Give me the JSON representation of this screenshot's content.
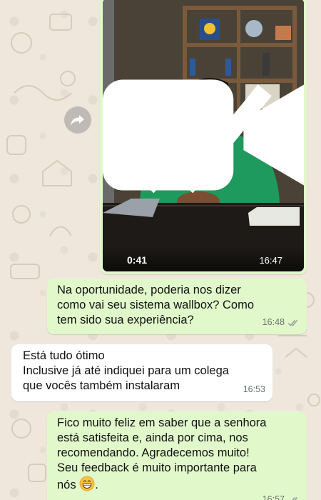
{
  "video": {
    "duration": "0:41",
    "time": "16:47",
    "icons": [
      "video-camera-icon",
      "play-icon",
      "forward-icon",
      "double-check-icon"
    ]
  },
  "messages": [
    {
      "direction": "outgoing",
      "lines": [
        "Na oportunidade, poderia nos dizer",
        "como vai seu sistema wallbox? Como",
        "tem sido sua experiência?"
      ],
      "time": "16:48",
      "status": "read"
    },
    {
      "direction": "incoming",
      "lines": [
        "Está tudo ótimo",
        "Inclusive já até indiquei para um colega",
        "que vocês também instalaram"
      ],
      "time": "16:53"
    },
    {
      "direction": "outgoing",
      "lines": [
        "Fico muito feliz em saber que a senhora",
        "está satisfeita e, ainda por cima, nos",
        "recomendando. Agradecemos muito!",
        "Seu feedback é muito importante para",
        "nós"
      ],
      "line_suffix": ".",
      "emoji": "grinning-face-emoji",
      "time": "16:57",
      "status": "read"
    }
  ],
  "colors": {
    "outgoing_bubble": "#e1f8cb",
    "incoming_bubble": "#ffffff",
    "wallpaper": "#efe7dc",
    "read_ticks": "#8fa39a"
  }
}
